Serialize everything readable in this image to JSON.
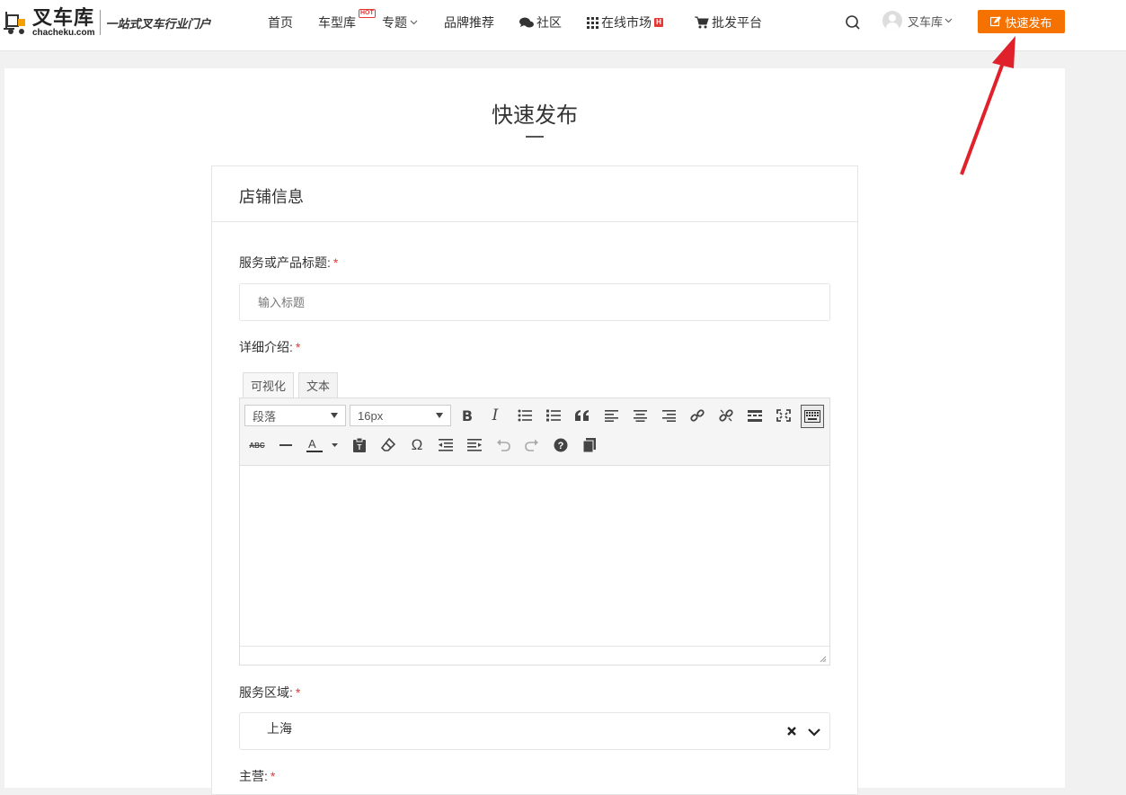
{
  "header": {
    "logo": {
      "name": "叉车库",
      "domain": "chacheku.com",
      "slogan": "一站式叉车行业门户"
    },
    "nav": [
      {
        "label": "首页"
      },
      {
        "label": "车型库",
        "badge": "HOT"
      },
      {
        "label": "专题"
      },
      {
        "label": "品牌推荐"
      },
      {
        "label": "社区"
      },
      {
        "label": "在线市场",
        "badge": "H"
      },
      {
        "label": "批发平台"
      }
    ],
    "user_name": "叉车库",
    "publish_button": "快速发布"
  },
  "page": {
    "title": "快速发布",
    "panel_title": "店铺信息",
    "fields": {
      "title_label": "服务或产品标题:",
      "title_placeholder": "输入标题",
      "detail_label": "详细介绍:",
      "area_label": "服务区域:",
      "area_value": "上海",
      "main_label": "主营:"
    },
    "editor": {
      "tabs": [
        "可视化",
        "文本"
      ],
      "paragraph_select": "段落",
      "fontsize_select": "16px"
    }
  },
  "colors": {
    "accent": "#f57200",
    "required": "#e53935",
    "annotation_arrow": "#e0202a"
  }
}
